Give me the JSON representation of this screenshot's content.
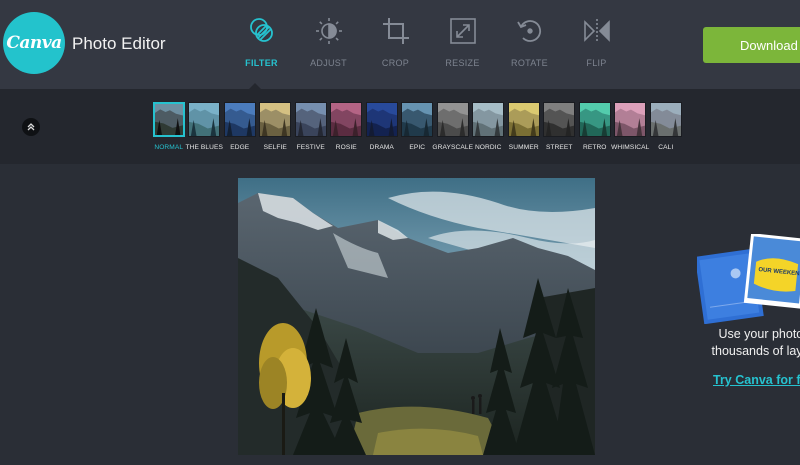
{
  "header": {
    "logo_text": "Canva",
    "app_title": "Photo Editor",
    "download_label": "Download"
  },
  "tools": [
    {
      "label": "FILTER",
      "icon": "filter-icon",
      "active": true
    },
    {
      "label": "ADJUST",
      "icon": "adjust-icon",
      "active": false
    },
    {
      "label": "CROP",
      "icon": "crop-icon",
      "active": false
    },
    {
      "label": "RESIZE",
      "icon": "resize-icon",
      "active": false
    },
    {
      "label": "ROTATE",
      "icon": "rotate-icon",
      "active": false
    },
    {
      "label": "FLIP",
      "icon": "flip-icon",
      "active": false
    }
  ],
  "filters": [
    {
      "label": "NORMAL",
      "active": true
    },
    {
      "label": "THE BLUES"
    },
    {
      "label": "EDGE"
    },
    {
      "label": "SELFIE"
    },
    {
      "label": "FESTIVE"
    },
    {
      "label": "ROSIE"
    },
    {
      "label": "DRAMA"
    },
    {
      "label": "EPIC"
    },
    {
      "label": "GRAYSCALE"
    },
    {
      "label": "NORDIC"
    },
    {
      "label": "SUMMER"
    },
    {
      "label": "STREET"
    },
    {
      "label": "RETRO"
    },
    {
      "label": "WHIMSICAL"
    },
    {
      "label": "CALI"
    }
  ],
  "promo": {
    "line1": "Use your photos",
    "line2": "thousands of layou",
    "link": "Try Canva for fre",
    "card_text": "OUR WEEKEND"
  },
  "colors": {
    "accent": "#26c2cf",
    "download": "#7cb63a",
    "topbar": "#343842",
    "strip": "#24272e",
    "background": "#2a2e36"
  }
}
